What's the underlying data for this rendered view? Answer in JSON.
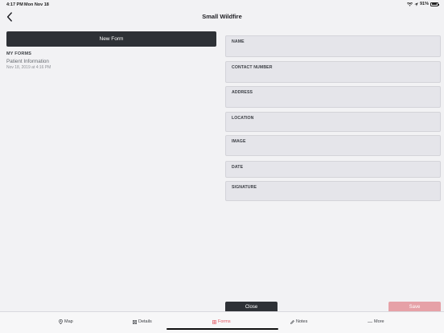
{
  "status_bar": {
    "time": "4:17 PM",
    "date": "Mon Nov 18",
    "battery_text": "91%",
    "battery_level": 0.91,
    "wifi_icon": "wifi-icon",
    "location_icon": "location-arrow-icon"
  },
  "header": {
    "title": "Small Wildfire",
    "back_icon": "chevron-left-icon"
  },
  "left_panel": {
    "new_form_label": "New Form",
    "my_forms_heading": "MY FORMS",
    "forms": [
      {
        "name": "Patient Information",
        "date": "Nov 18, 2019 at 4:16 PM"
      }
    ]
  },
  "form_fields": [
    {
      "label": "NAME"
    },
    {
      "label": "CONTACT NUMBER"
    },
    {
      "label": "ADDRESS"
    },
    {
      "label": "LOCATION"
    },
    {
      "label": "IMAGE"
    },
    {
      "label": "DATE"
    },
    {
      "label": "SIGNATURE"
    }
  ],
  "actions": {
    "close_label": "Close",
    "save_label": "Save"
  },
  "tab_bar": {
    "tabs": [
      {
        "label": "Map",
        "icon": "map-pin-icon"
      },
      {
        "label": "Details",
        "icon": "details-icon"
      },
      {
        "label": "Forms",
        "icon": "forms-icon",
        "active": true
      },
      {
        "label": "Notes",
        "icon": "pencil-icon"
      },
      {
        "label": "More",
        "icon": "more-dots-icon"
      }
    ]
  },
  "colors": {
    "accent": "#e3555f",
    "dark_button": "#2e3136",
    "save_disabled": "#e6a1a7",
    "field_bg": "#e5e5ea"
  }
}
